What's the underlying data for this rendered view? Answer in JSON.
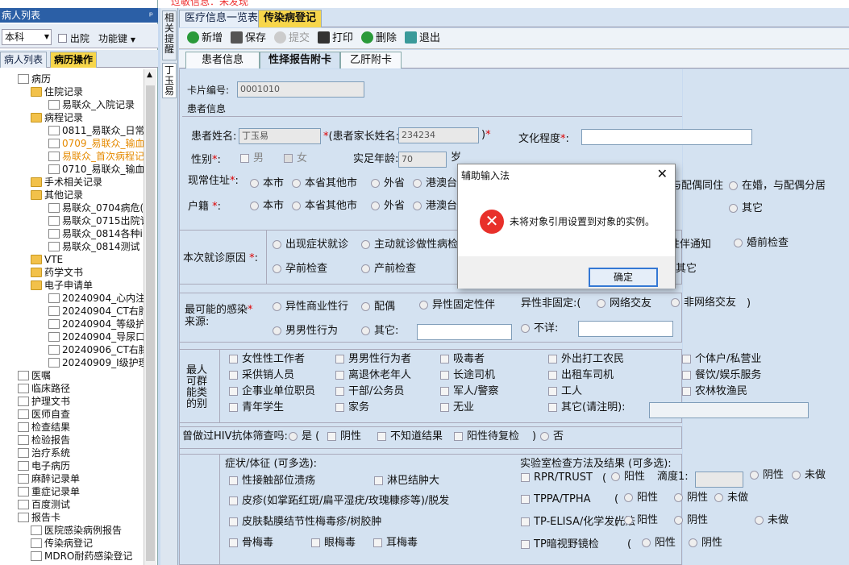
{
  "top_notice": "过敏信息：未发现",
  "left": {
    "header": "病人列表",
    "pin": "ᵖ",
    "dept": "本科",
    "discharge_label": "出院",
    "func_label": "功能键",
    "tabs": [
      "病人列表",
      "病历操作"
    ],
    "tree": [
      {
        "t": "病历",
        "lv": 0,
        "k": "doc"
      },
      {
        "t": "住院记录",
        "lv": 1,
        "k": "fold"
      },
      {
        "t": "易联众_入院记录",
        "lv": 2,
        "k": "doc"
      },
      {
        "t": "病程记录",
        "lv": 1,
        "k": "fold"
      },
      {
        "t": "0811_易联众_日常",
        "lv": 2,
        "k": "doc"
      },
      {
        "t": "0709_易联众_输血",
        "lv": 2,
        "k": "doc",
        "or": true
      },
      {
        "t": "易联众_首次病程记",
        "lv": 2,
        "k": "doc",
        "or": true
      },
      {
        "t": "0710_易联众_输血",
        "lv": 2,
        "k": "doc"
      },
      {
        "t": "手术相关记录",
        "lv": 1,
        "k": "fold"
      },
      {
        "t": "其他记录",
        "lv": 1,
        "k": "fold"
      },
      {
        "t": "易联众_0704病危(",
        "lv": 2,
        "k": "doc"
      },
      {
        "t": "易联众_0715出院讠",
        "lv": 2,
        "k": "doc"
      },
      {
        "t": "易联众_0814各种i",
        "lv": 2,
        "k": "doc"
      },
      {
        "t": "易联众_0814测试",
        "lv": 2,
        "k": "doc"
      },
      {
        "t": "VTE",
        "lv": 1,
        "k": "fold"
      },
      {
        "t": "药学文书",
        "lv": 1,
        "k": "fold"
      },
      {
        "t": "电子申请单",
        "lv": 1,
        "k": "fold"
      },
      {
        "t": "20240904_心内注身",
        "lv": 2,
        "k": "doc"
      },
      {
        "t": "20240904_CT右肘主",
        "lv": 2,
        "k": "doc"
      },
      {
        "t": "20240904_等级护耳",
        "lv": 2,
        "k": "doc"
      },
      {
        "t": "20240904_导尿口扌",
        "lv": 2,
        "k": "doc"
      },
      {
        "t": "20240906_CT右膝主",
        "lv": 2,
        "k": "doc"
      },
      {
        "t": "20240909_Ⅰ级护理",
        "lv": 2,
        "k": "doc"
      },
      {
        "t": "医嘱",
        "lv": 0,
        "k": "doc"
      },
      {
        "t": "临床路径",
        "lv": 0,
        "k": "doc"
      },
      {
        "t": "护理文书",
        "lv": 0,
        "k": "doc"
      },
      {
        "t": "医师自查",
        "lv": 0,
        "k": "doc"
      },
      {
        "t": "检查结果",
        "lv": 0,
        "k": "doc"
      },
      {
        "t": "检验报告",
        "lv": 0,
        "k": "doc"
      },
      {
        "t": "治疗系统",
        "lv": 0,
        "k": "doc"
      },
      {
        "t": "电子病历",
        "lv": 0,
        "k": "doc"
      },
      {
        "t": "麻醉记录单",
        "lv": 0,
        "k": "doc"
      },
      {
        "t": "重症记录单",
        "lv": 0,
        "k": "doc"
      },
      {
        "t": "百度测试",
        "lv": 0,
        "k": "doc"
      },
      {
        "t": "报告卡",
        "lv": 0,
        "k": "doc"
      },
      {
        "t": "医院感染病例报告",
        "lv": 1,
        "k": "doc"
      },
      {
        "t": "传染病登记",
        "lv": 1,
        "k": "doc"
      },
      {
        "t": "MDRO耐药感染登记",
        "lv": 1,
        "k": "doc"
      }
    ]
  },
  "side_tabs": [
    "相关提醒",
    "丁玉易"
  ],
  "top_tabs": [
    "医疗信息一览表",
    "传染病登记"
  ],
  "toolbar": {
    "new": "新增",
    "save": "保存",
    "submit": "提交",
    "print": "打印",
    "delete": "删除",
    "exit": "退出"
  },
  "sub_tabs": [
    "患者信息",
    "性择报告附卡",
    "乙肝附卡"
  ],
  "form": {
    "card_no_label": "卡片编号:",
    "card_no": "0001010",
    "patient_info": "患者信息",
    "name_label": "患者姓名:",
    "name": "丁玉易",
    "parent_label": "(患者家长姓名:",
    "parent": "234234",
    "edu_label": "文化程度",
    "sex_label": "性别",
    "male": "男",
    "female": "女",
    "age_label": "实足年龄:",
    "age": "70",
    "age_unit": "岁",
    "addr_label": "现常住址",
    "residence_label": "户籍",
    "loc_opts": [
      "本市",
      "本省其他市",
      "外省",
      "港澳台"
    ],
    "marriage_opts": [
      "与配偶同住",
      "在婚，与配偶分居",
      "其它"
    ],
    "visit_label": "本次就诊原因",
    "visit_opts": [
      "出现症状就诊",
      "主动就诊做性病检",
      "性伴通知",
      "婚前检查",
      "孕前检查",
      "产前检查",
      "其它"
    ],
    "infect_label1": "最可能的感染",
    "infect_label2": "来源:",
    "infect_opts": [
      "异性商业性行",
      "配偶",
      "异性固定性伴",
      "异性非固定:(",
      "网络交友",
      "非网络交友",
      ")",
      "男男性行为",
      "其它:",
      "不详:"
    ],
    "group_label": "最人可群能类的别",
    "groups": [
      [
        "女性性工作者",
        "男男性行为者",
        "吸毒者",
        "外出打工农民",
        "个体户/私营业"
      ],
      [
        "采供销人员",
        "离退休老年人",
        "长途司机",
        "出租车司机",
        "餐饮/娱乐服务"
      ],
      [
        "企事业单位职员",
        "干部/公务员",
        "军人/警察",
        "工人",
        "农林牧渔民"
      ],
      [
        "青年学生",
        "家务",
        "无业",
        "其它(请注明):"
      ]
    ],
    "hiv_label": "曾做过HIV抗体筛查吗:",
    "hiv_opts": [
      "是 (",
      "阴性",
      "不知道结果",
      "阳性待复检",
      ")",
      "否"
    ],
    "symptom_label": "症状/体征 (可多选):",
    "lab_label": "实验室检查方法及结果 (可多选):",
    "symptoms": [
      "性接触部位溃疡",
      "淋巴结肿大",
      "皮疹(如掌跖红斑/扁平湿疣/玫瑰糠疹等)/脱发",
      "皮肤黏膜结节性梅毒疹/树胶肿",
      "骨梅毒",
      "眼梅毒",
      "耳梅毒"
    ],
    "labs": [
      "RPR/TRUST",
      "TPPA/TPHA",
      "TP-ELISA/化学发光法",
      "TP暗视野镜检"
    ],
    "titer": "滴度1:",
    "pos": "阳性",
    "neg": "阴性",
    "undone": "未做"
  },
  "dialog": {
    "title": "辅助输入法",
    "message": "未将对象引用设置到对象的实例。",
    "ok": "确定",
    "close": "✕",
    "err": "✕"
  }
}
